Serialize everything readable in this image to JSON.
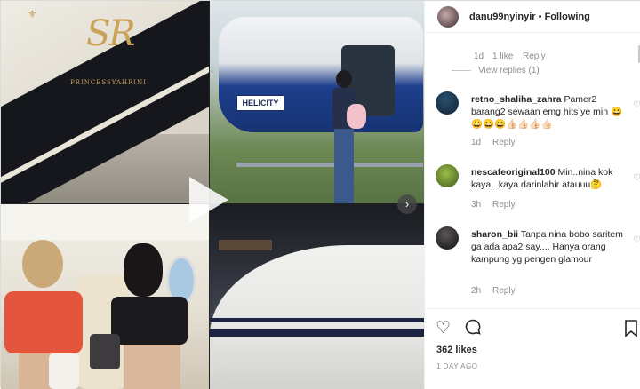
{
  "media": {
    "logo_text": "SR",
    "logo_sub": "PRINCESSYAHRINI",
    "heli_tag": "HELICITY"
  },
  "header": {
    "username": "danu99nyinyir",
    "separator": "•",
    "follow_label": "Following"
  },
  "first_meta": {
    "time": "1d",
    "likes": "1 like",
    "reply": "Reply",
    "view_replies": "View replies (1)"
  },
  "comments": [
    {
      "username": "retno_shaliha_zahra",
      "text": "Pamer2 barang2 sewaan emg hits ye min 😀😀😀😀👍🏻👍🏻👍🏻👍🏻",
      "time": "1d",
      "reply": "Reply"
    },
    {
      "username": "nescafeoriginal100",
      "text": "Min..nina kok kaya ..kaya darinlahir atauuu🤔",
      "time": "3h",
      "reply": "Reply"
    },
    {
      "username": "sharon_bii",
      "text": "Tanpa nina bobo saritem ga ada apa2 say.... Hanya orang kampung yg pengen glamour",
      "time": "2h",
      "reply": "Reply"
    }
  ],
  "actions": {
    "likes": "362 likes",
    "date": "1 DAY AGO"
  },
  "icons": {
    "heart": "heart-icon",
    "comment": "comment-icon",
    "bookmark": "bookmark-icon",
    "play": "play-icon",
    "next": "chevron-right-icon"
  }
}
